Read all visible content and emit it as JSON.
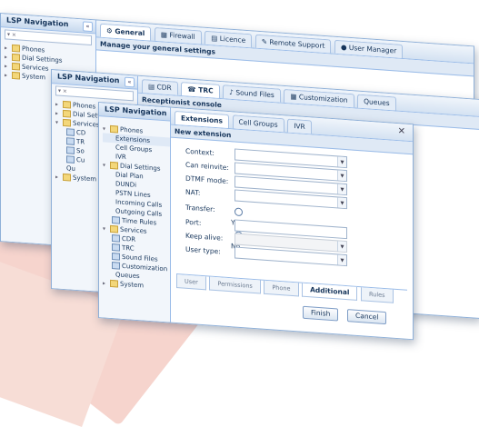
{
  "colors": {
    "accent": "#99bbe8",
    "header": "#c7d9ee",
    "decor": "#f4cdc4"
  },
  "back": {
    "nav_title": "LSP Navigation",
    "tabs": [
      "General",
      "Firewall",
      "Licence",
      "Remote Support",
      "User Manager"
    ],
    "subheader": "Manage your general settings",
    "tree": [
      "Phones",
      "Dial Settings",
      "Services",
      "System"
    ]
  },
  "middle": {
    "nav_title": "LSP Navigation",
    "tabs": [
      "CDR",
      "TRC",
      "Sound Files",
      "Customization",
      "Queues"
    ],
    "subheader": "Receptionist console",
    "tree": [
      "Phones",
      "Dial Settings",
      "Services",
      "CD",
      "TR",
      "So",
      "Cu",
      "Qu",
      "System"
    ]
  },
  "front": {
    "nav_title": "LSP Navigation",
    "tabs": [
      "Extensions",
      "Cell Groups",
      "IVR"
    ],
    "dialog_title": "New extension",
    "tree": [
      {
        "label": "Phones",
        "level": 0,
        "icon": "folder"
      },
      {
        "label": "Extensions",
        "level": 1,
        "icon": "phone"
      },
      {
        "label": "Cell Groups",
        "level": 1,
        "icon": ""
      },
      {
        "label": "IVR",
        "level": 1,
        "icon": ""
      },
      {
        "label": "Dial Settings",
        "level": 0,
        "icon": "folder"
      },
      {
        "label": "Dial Plan",
        "level": 1,
        "icon": ""
      },
      {
        "label": "DUNDi",
        "level": 1,
        "icon": ""
      },
      {
        "label": "PSTN Lines",
        "level": 1,
        "icon": ""
      },
      {
        "label": "Incoming Calls",
        "level": 1,
        "icon": ""
      },
      {
        "label": "Outgoing Calls",
        "level": 1,
        "icon": ""
      },
      {
        "label": "Time Rules",
        "level": 1,
        "icon": "phone"
      },
      {
        "label": "Services",
        "level": 0,
        "icon": "folder"
      },
      {
        "label": "CDR",
        "level": 1,
        "icon": "phone"
      },
      {
        "label": "TRC",
        "level": 1,
        "icon": "phone"
      },
      {
        "label": "Sound Files",
        "level": 1,
        "icon": "phone"
      },
      {
        "label": "Customization",
        "level": 1,
        "icon": "phone"
      },
      {
        "label": "Queues",
        "level": 1,
        "icon": ""
      },
      {
        "label": "System",
        "level": 0,
        "icon": "folder"
      }
    ],
    "form": {
      "context": "Context:",
      "can_reinvite": "Can reinvite:",
      "dtmf_mode": "DTMF mode:",
      "nat": "NAT:",
      "transfer": "Transfer:",
      "transfer_yes": "Yes",
      "transfer_no": "No",
      "port": "Port:",
      "keep_alive": "Keep alive:",
      "user_type": "User type:"
    },
    "bottom_tabs": [
      "User",
      "Permissions",
      "Phone",
      "Additional",
      "Rules"
    ],
    "active_bottom_tab": "Additional",
    "buttons": {
      "finish": "Finish",
      "cancel": "Cancel"
    }
  }
}
